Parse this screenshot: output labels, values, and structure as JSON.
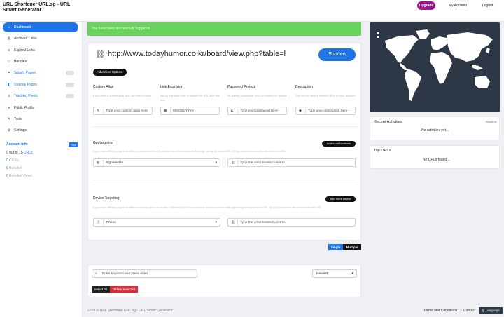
{
  "header": {
    "brand": "URL Shortener URL.sg - URL Smart Generator",
    "upgrade": "Upgrade",
    "my_account": "My Account",
    "logout": "Logout"
  },
  "sidebar": {
    "items": [
      {
        "label": "Dashboard",
        "icon": "home-icon",
        "active": true
      },
      {
        "label": "Archived Links",
        "icon": "archive-icon"
      },
      {
        "label": "Expired Links",
        "icon": "list-icon"
      },
      {
        "label": "Bundles",
        "icon": "folder-icon"
      },
      {
        "label": "Splash Pages",
        "icon": "splash-icon",
        "pro": true
      },
      {
        "label": "Overlay Pages",
        "icon": "overlay-icon",
        "pro": true
      },
      {
        "label": "Tracking Pixels",
        "icon": "pixel-icon",
        "pro": true
      },
      {
        "label": "Public Profile",
        "icon": "user-icon"
      },
      {
        "label": "Tools",
        "icon": "wrench-icon"
      },
      {
        "label": "Settings",
        "icon": "gear-icon"
      }
    ],
    "account": {
      "title": "Account Info",
      "plan_badge": "Free",
      "urls_used": "0 out of 15",
      "urls_suffix": "URLs",
      "clicks_count": "0",
      "clicks_label": "Clicks",
      "bundles_count": "0",
      "bundles_label": "Bundles",
      "bundle_views_count": "0",
      "bundle_views_label": "Bundles Views"
    }
  },
  "alert": "You have been successfully logged in.",
  "shortener": {
    "url_value": "http://www.todayhumor.co.kr/board/view.php?table=l",
    "shorten_label": "Shorten",
    "advanced_label": "Advanced Options",
    "fields": [
      {
        "title": "Custom Alias",
        "hint": "If you need a custom alias, you can enter it below.",
        "placeholder": "Type your custom alias here",
        "icon": "pencil-icon"
      },
      {
        "title": "Link Expiration",
        "hint": "Set an expiration date to disable the URL after this date.",
        "placeholder": "MM/DD/YYYY",
        "icon": "calendar-icon"
      },
      {
        "title": "Password Protect",
        "hint": "By adding a password, you can restrict the access.",
        "placeholder": "Type your password here",
        "icon": "lock-icon"
      },
      {
        "title": "Description",
        "hint": "This can be used to identify URLs on your account.",
        "placeholder": "Type your description here",
        "icon": "tag-icon"
      }
    ],
    "geo": {
      "title": "Geotargeting",
      "add_label": "Add more locations",
      "hint": "If you have different pages for different countries then it is possible to redirect users to that page using the same URL. Simply choose the country and enter the URL.",
      "country": "Afghanistan",
      "url_placeholder": "Type the url to redirect user to."
    },
    "device": {
      "title": "Device Targeting",
      "add_label": "Add more device",
      "hint": "If you have different pages for different devices (such as mobile, tablet etc) then it is possible to redirect users to that page using the same short URL. Simply choose the device and enter the URL.",
      "device": "iPhone",
      "url_placeholder": "Type the url to redirect user to."
    }
  },
  "toggle": {
    "single": "Single",
    "multiple": "Multiple"
  },
  "search": {
    "placeholder": "Enter keyword and press enter",
    "sort": "Newest",
    "select_all": "Select All",
    "delete_selected": "Delete Selected"
  },
  "right": {
    "recent_title": "Recent Activities",
    "recent_link": "Realtime",
    "recent_empty": "No activities yet...",
    "top_title": "Top URLs",
    "top_empty": "No URLs found..."
  },
  "footer": {
    "copyright": "2018 © URL Shortener URL.sg - URL Smart Generator.",
    "terms": "Terms and Conditions",
    "contact": "Contact",
    "language": "Language"
  },
  "colors": {
    "primary": "#1f74e6",
    "success": "#6ad35e",
    "danger": "#d4303c",
    "map_bg": "#2d3746",
    "upgrade": "#9b1a8d"
  }
}
